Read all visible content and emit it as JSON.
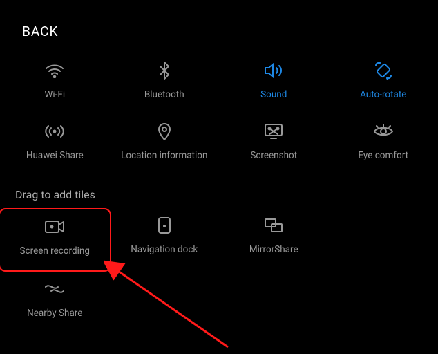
{
  "header": {
    "back_label": "BACK"
  },
  "section": {
    "add_tiles_title": "Drag to add tiles"
  },
  "tiles": {
    "wifi": "Wi-Fi",
    "bluetooth": "Bluetooth",
    "sound": "Sound",
    "autorotate": "Auto-rotate",
    "huawei_share": "Huawei Share",
    "location": "Location information",
    "screenshot": "Screenshot",
    "eye_comfort": "Eye comfort",
    "screen_recording": "Screen recording",
    "navigation_dock": "Navigation dock",
    "mirror_share": "MirrorShare",
    "nearby_share": "Nearby Share"
  },
  "colors": {
    "active": "#1e88e5",
    "inactive": "#999999",
    "highlight": "#ff1a1a"
  }
}
